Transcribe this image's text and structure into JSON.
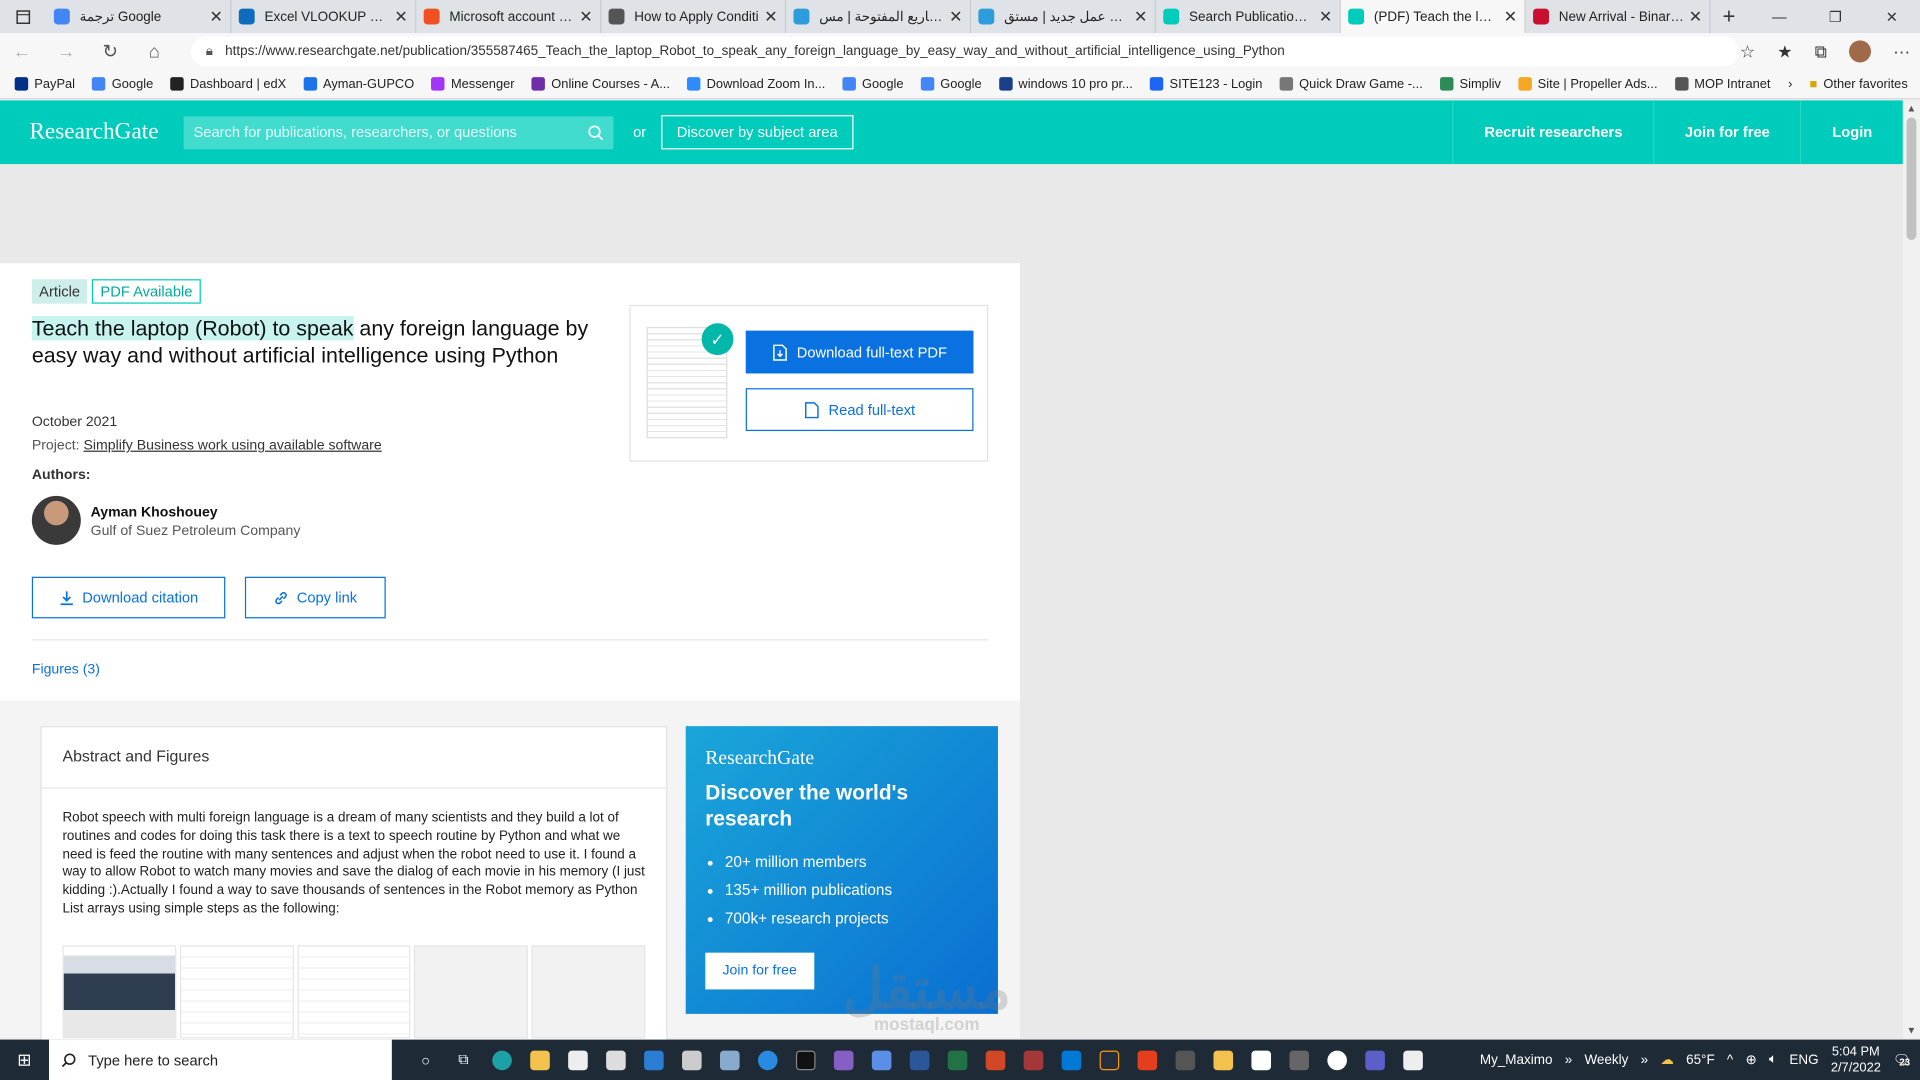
{
  "browser": {
    "tabs": [
      {
        "title": "ترجمة Google",
        "color": "#4285f4"
      },
      {
        "title": "Excel VLOOKUP with s",
        "color": "#0f6cbd"
      },
      {
        "title": "Microsoft account | M",
        "color": "#f25022"
      },
      {
        "title": "How to Apply Conditi",
        "color": "#555555"
      },
      {
        "title": "المشاريع المفتوحة | مس",
        "color": "#2d9cdb"
      },
      {
        "title": "إضافة عمل جديد | مستق",
        "color": "#2d9cdb"
      },
      {
        "title": "Search Publications | R",
        "color": "#00ccbb"
      },
      {
        "title": "(PDF) Teach the laptop",
        "color": "#00ccbb"
      },
      {
        "title": "New Arrival - Binary C",
        "color": "#c8102e"
      }
    ],
    "active_tab": 7,
    "url": "https://www.researchgate.net/publication/355587465_Teach_the_laptop_Robot_to_speak_any_foreign_language_by_easy_way_and_without_artificial_intelligence_using_Python",
    "bookmarks": [
      {
        "label": "PayPal",
        "color": "#003087"
      },
      {
        "label": "Google",
        "color": "#4285f4"
      },
      {
        "label": "Dashboard | edX",
        "color": "#222222"
      },
      {
        "label": "Ayman-GUPCO",
        "color": "#1a73e8"
      },
      {
        "label": "Messenger",
        "color": "#a334fa"
      },
      {
        "label": "Online Courses - A...",
        "color": "#6f2da8"
      },
      {
        "label": "Download Zoom In...",
        "color": "#2d8cff"
      },
      {
        "label": "Google",
        "color": "#4285f4"
      },
      {
        "label": "Google",
        "color": "#4285f4"
      },
      {
        "label": "windows 10 pro pr...",
        "color": "#1a3f8a"
      },
      {
        "label": "SITE123 - Login",
        "color": "#1c64f2"
      },
      {
        "label": "Quick Draw Game -...",
        "color": "#777777"
      },
      {
        "label": "Simpliv",
        "color": "#2e8b57"
      },
      {
        "label": "Site | Propeller Ads...",
        "color": "#f5a623"
      },
      {
        "label": "MOP Intranet",
        "color": "#555555"
      }
    ],
    "other_favorites": "Other favorites"
  },
  "header": {
    "logo": "ResearchGate",
    "search_placeholder": "Search for publications, researchers, or questions",
    "or": "or",
    "discover": "Discover by subject area",
    "recruit": "Recruit researchers",
    "join": "Join for free",
    "login": "Login"
  },
  "publication": {
    "badge_type": "Article",
    "badge_pdf": "PDF Available",
    "title_highlight": "Teach the laptop (Robot) to speak",
    "title_rest": " any foreign language by easy way and without artificial intelligence using Python",
    "date": "October 2021",
    "project_label": "Project:",
    "project_name": "Simplify Business work using available software",
    "authors_label": "Authors:",
    "author_name": "Ayman Khoshouey",
    "author_affiliation": "Gulf of Suez Petroleum Company",
    "download_citation": "Download citation",
    "copy_link": "Copy link",
    "figures_link": "Figures (3)",
    "download_pdf": "Download full-text PDF",
    "read_fulltext": "Read full-text"
  },
  "abstract": {
    "heading": "Abstract and Figures",
    "text": "Robot speech with multi foreign language is a dream of many scientists and they build a lot of routines and codes for doing this task there is a text to speech routine by Python and what we need is feed the routine with many sentences and adjust when the robot need to use it. I found a way to allow Robot to watch many movies and save the dialog of each movie in his memory (I just kidding :).Actually I found a way to save thousands of sentences in the Robot memory as Python List arrays using simple steps as the following:"
  },
  "promo": {
    "logo": "ResearchGate",
    "heading": "Discover the world's research",
    "items": [
      "20+ million members",
      "135+ million publications",
      "700k+ research projects"
    ],
    "join": "Join for free"
  },
  "watermark": {
    "main": "مستقل",
    "sub": "mostaql.com"
  },
  "taskbar": {
    "search_placeholder": "Type here to search",
    "tray_app1": "My_Maximo",
    "tray_app2": "Weekly",
    "temperature": "65°F",
    "language": "ENG",
    "time": "5:04 PM",
    "date": "2/7/2022",
    "notifications": "23"
  }
}
